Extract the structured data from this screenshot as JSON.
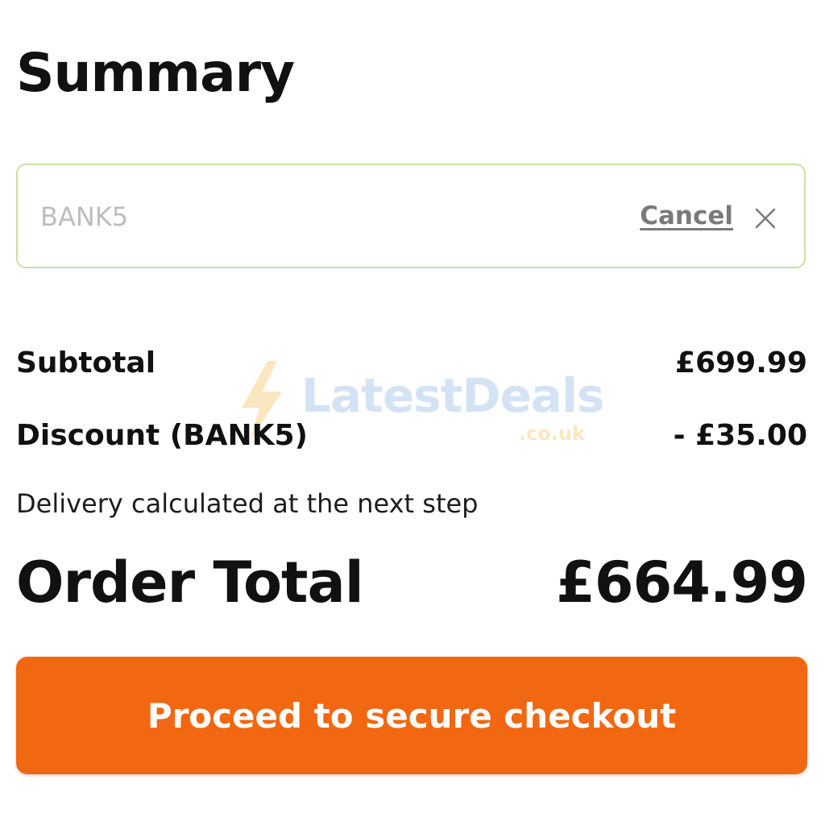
{
  "summary": {
    "title": "Summary"
  },
  "coupon": {
    "placeholder": "BANK5",
    "cancel_label": "Cancel",
    "close_icon": "close-icon"
  },
  "lines": {
    "subtotal_label": "Subtotal",
    "subtotal_value": "£699.99",
    "discount_label": "Discount (BANK5)",
    "discount_value": "- £35.00",
    "delivery_note": "Delivery calculated at the next step",
    "total_label": "Order Total",
    "total_value": "£664.99"
  },
  "watermark": {
    "brand": "LatestDeals",
    "domain": ".co.uk"
  },
  "checkout": {
    "button_label": "Proceed to secure checkout"
  },
  "colors": {
    "accent": "#f26711",
    "input_border": "#c9e0a8",
    "muted_text": "#7a7a7a"
  }
}
